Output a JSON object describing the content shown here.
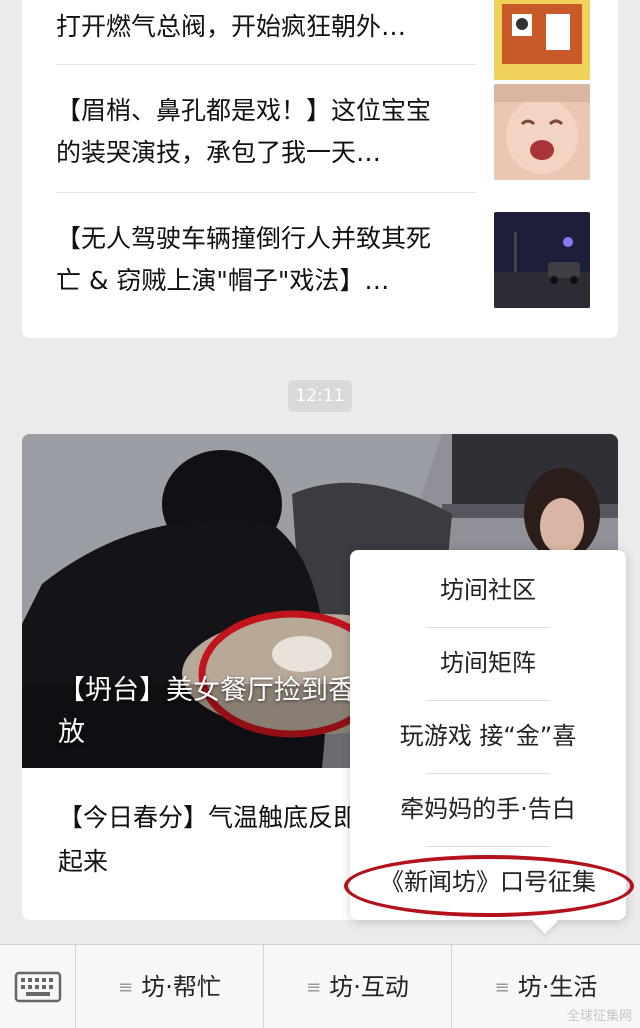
{
  "articles": [
    {
      "title": "打开燃气总阀，开始疯狂朝外…",
      "thumb": "cartoon-thumb"
    },
    {
      "title": "【眉梢、鼻孔都是戏！】这位宝宝的装哭演技，承包了我一天…",
      "thumb": "crying-baby-thumb"
    },
    {
      "title": "【无人驾驶车辆撞倒行人并致其死亡 & 窃贼上演\"帽子\"戏法】…",
      "thumb": "night-car-thumb"
    }
  ],
  "time_chip": "12:11",
  "featured": {
    "caption": "【坍台】美女餐厅捡到香水，竟心安理得地放",
    "sub_title": "【今日春分】气温触底反即，这些东西可以吃起来"
  },
  "popup_menu": {
    "items": [
      "坊间社区",
      "坊间矩阵",
      "玩游戏 接“金”喜",
      "牵妈妈的手·告白",
      "《新闻坊》口号征集"
    ],
    "highlight_color": "#b3121c"
  },
  "bottom_bar": {
    "keyboard_icon": "keyboard-icon",
    "tabs": [
      "坊·帮忙",
      "坊·互动",
      "坊·生活"
    ],
    "menu_glyph": "≡"
  },
  "watermark": "全球征集网"
}
